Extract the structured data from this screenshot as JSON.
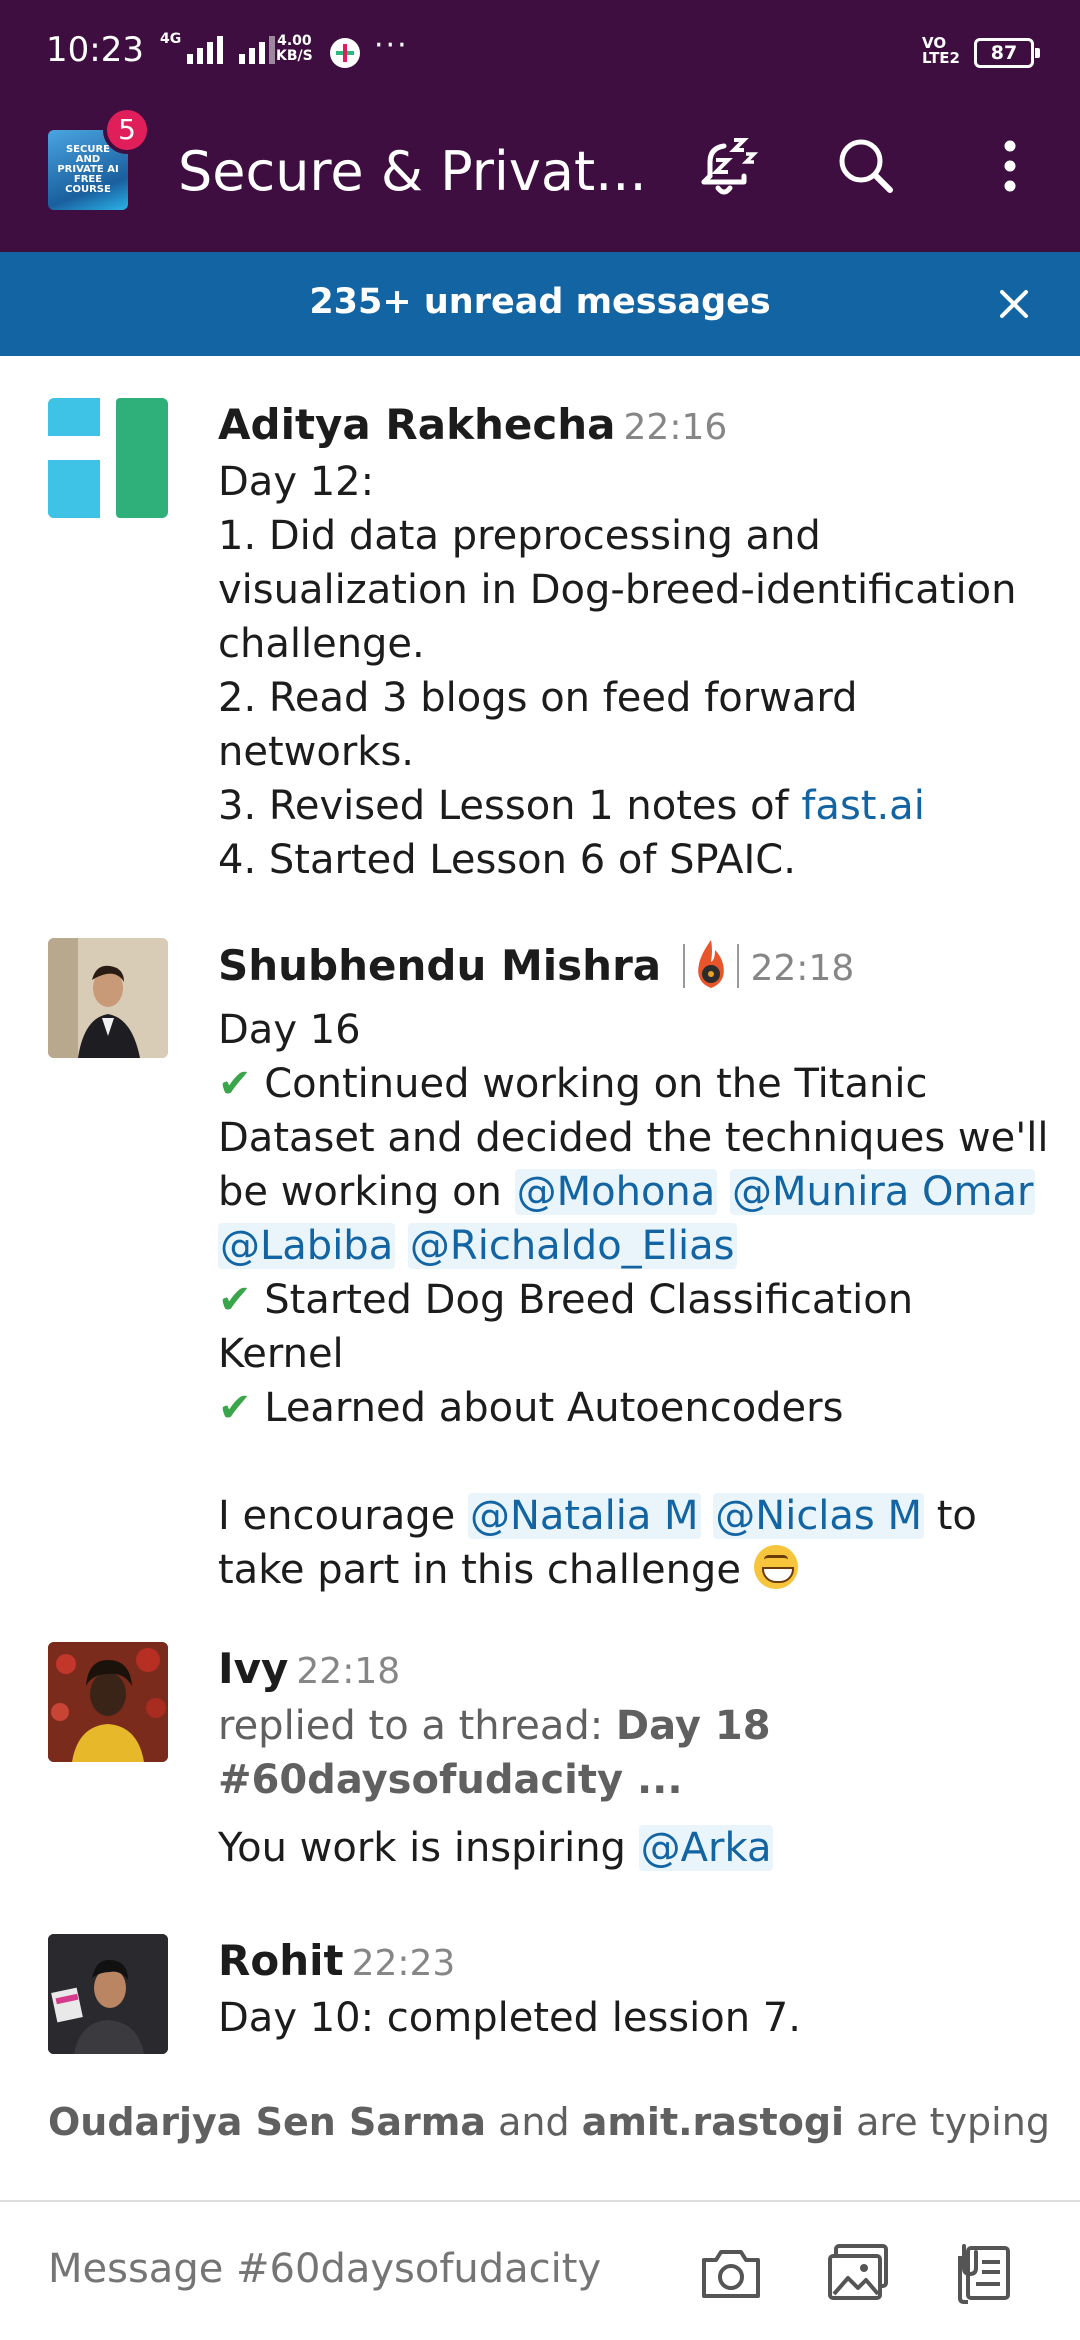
{
  "status_bar": {
    "time": "10:23",
    "network": "4G",
    "speed_value": "4.00",
    "speed_unit": "KB/S",
    "overflow": "···",
    "volte_top": "VO",
    "volte_bottom": "LTE2",
    "battery": "87"
  },
  "header": {
    "workspace_icon_text": "SECURE AND PRIVATE AI FREE COURSE",
    "notification_count": "5",
    "channel_title": "Secure & Privat..."
  },
  "banner": {
    "text": "235+ unread messages"
  },
  "messages": [
    {
      "author": "Aditya Rakhecha",
      "time": "22:16",
      "lines": [
        "Day 12:",
        "1. Did data preprocessing and",
        "visualization in Dog-breed-identification",
        "challenge.",
        "2. Read 3 blogs on feed forward",
        "networks.",
        "3. Revised Lesson 1 notes of ",
        "4. Started Lesson 6 of SPAIC."
      ],
      "link": "fast.ai"
    },
    {
      "author": "Shubhendu Mishra",
      "time": "22:18",
      "day": "Day 16",
      "check": "✔",
      "line1a": "Continued working on the Titanic",
      "line1b": "Dataset and decided the techniques we'll",
      "line1c": "be working on ",
      "mentions": [
        "@Mohona",
        "@Munira Omar",
        "@Labiba",
        "@Richaldo_Elias"
      ],
      "line2a": "Started Dog Breed Classification",
      "line2b": "Kernel",
      "line3": "Learned about Autoencoders",
      "encourage_a": "I encourage ",
      "encourage_mentions": [
        "@Natalia M",
        "@Niclas M"
      ],
      "encourage_b": " to",
      "encourage_c": "take part in this challenge "
    },
    {
      "author": "Ivy",
      "time": "22:18",
      "thread_prefix": "replied to a thread: ",
      "thread_title_a": "Day 18",
      "thread_title_b": "#60daysofudacity ...",
      "text": "You work is inspiring ",
      "mention": "@Arka"
    },
    {
      "author": "Rohit",
      "time": "22:23",
      "text": "Day 10: completed lession 7."
    }
  ],
  "typing": {
    "user1": "Oudarjya Sen Sarma",
    "and": " and ",
    "user2": "amit.rastogi",
    "suffix": " are typing"
  },
  "composer": {
    "placeholder": "Message #60daysofudacity"
  },
  "colors": {
    "header_bg": "#3f0e40",
    "banner_bg": "#1264a3",
    "badge": "#e01e5a",
    "link": "#1264a3"
  },
  "icons": [
    "workspace-icon",
    "snooze-bell-icon",
    "search-icon",
    "more-vert-icon",
    "close-icon",
    "camera-icon",
    "image-icon",
    "files-icon",
    "fire-badge-icon",
    "check-icon",
    "grin-emoji-icon"
  ]
}
